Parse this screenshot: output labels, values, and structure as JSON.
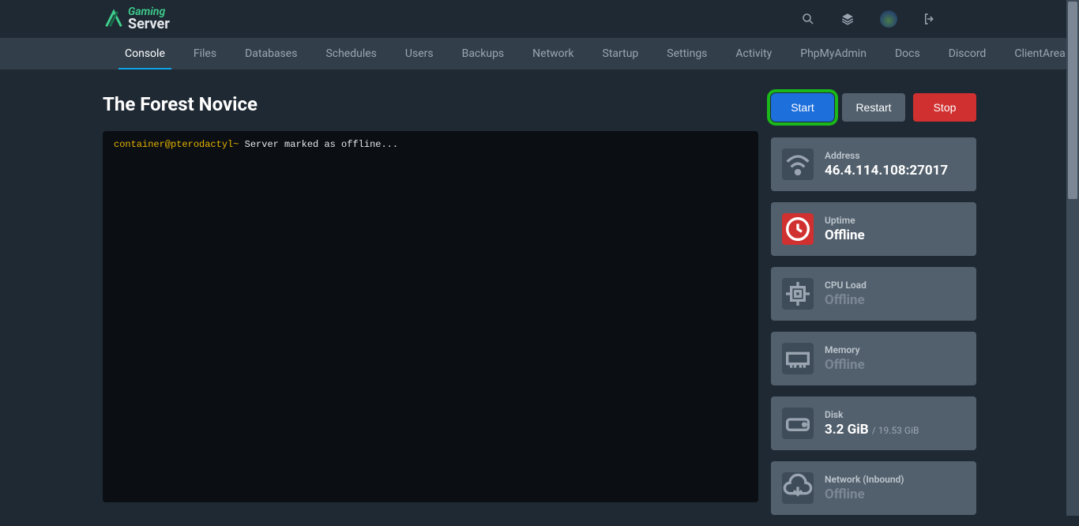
{
  "brand": {
    "top": "Gaming",
    "bottom": "Server"
  },
  "nav": {
    "items": [
      {
        "label": "Console",
        "active": true
      },
      {
        "label": "Files"
      },
      {
        "label": "Databases"
      },
      {
        "label": "Schedules"
      },
      {
        "label": "Users"
      },
      {
        "label": "Backups"
      },
      {
        "label": "Network"
      },
      {
        "label": "Startup"
      },
      {
        "label": "Settings"
      },
      {
        "label": "Activity"
      },
      {
        "label": "PhpMyAdmin"
      },
      {
        "label": "Docs"
      },
      {
        "label": "Discord"
      },
      {
        "label": "ClientArea"
      }
    ]
  },
  "server_name": "The Forest Novice",
  "power": {
    "start": "Start",
    "restart": "Restart",
    "stop": "Stop"
  },
  "console_lines": [
    {
      "prompt": "container@pterodactyl~",
      "text": " Server marked as offline..."
    }
  ],
  "stats": {
    "address": {
      "label": "Address",
      "value": "46.4.114.108:27017"
    },
    "uptime": {
      "label": "Uptime",
      "value": "Offline"
    },
    "cpu": {
      "label": "CPU Load",
      "value": "Offline"
    },
    "memory": {
      "label": "Memory",
      "value": "Offline"
    },
    "disk": {
      "label": "Disk",
      "value": "3.2 GiB",
      "sub": "/ 19.53 GiB"
    },
    "net_in": {
      "label": "Network (Inbound)",
      "value": "Offline"
    }
  }
}
